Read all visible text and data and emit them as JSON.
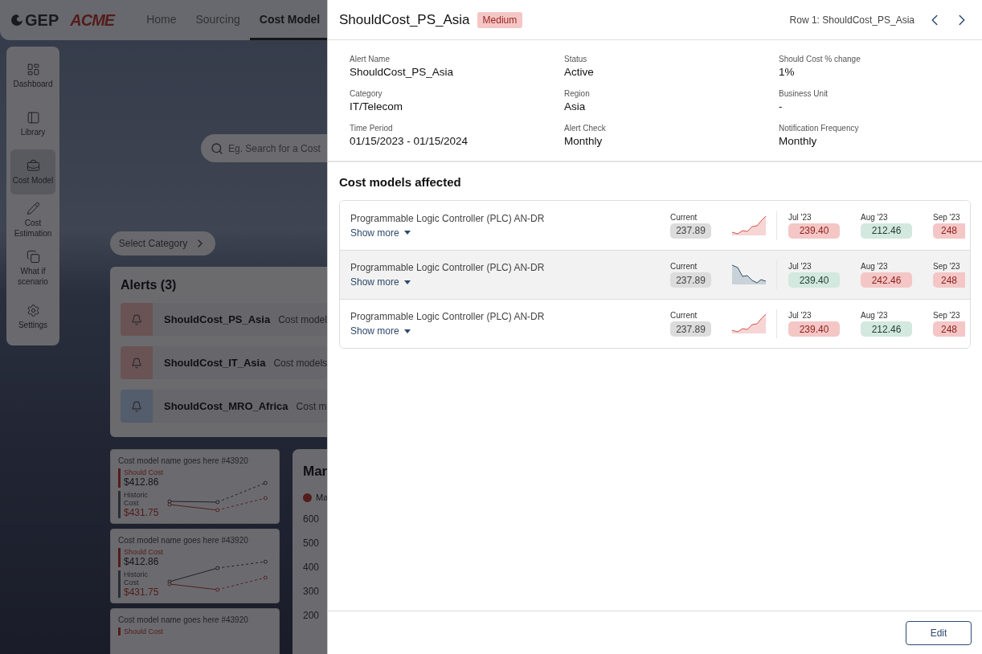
{
  "app": {
    "logo": "GEP",
    "brand": "ACME",
    "nav": [
      {
        "label": "Home",
        "selected": false
      },
      {
        "label": "Sourcing",
        "selected": false
      },
      {
        "label": "Cost Model",
        "selected": true
      }
    ],
    "sidebar": [
      {
        "label": "Dashboard",
        "selected": false
      },
      {
        "label": "Library",
        "selected": false
      },
      {
        "label": "Cost Model",
        "selected": true
      },
      {
        "label": "Cost Estimation",
        "selected": false
      },
      {
        "label": "What if scenario",
        "selected": false
      },
      {
        "label": "Settings",
        "selected": false
      }
    ],
    "search": {
      "placeholder": "Eg. Search for a Cost"
    },
    "category_button": "Select Category",
    "alerts": {
      "title": "Alerts (3)",
      "items": [
        {
          "name": "ShouldCost_PS_Asia",
          "text": "Cost model",
          "kind": "warning"
        },
        {
          "name": "ShouldCost_IT_Asia",
          "text": "Cost models",
          "kind": "warning"
        },
        {
          "name": "ShouldCost_MRO_Africa",
          "text": "Cost m",
          "kind": "info"
        }
      ]
    },
    "cost_cards": [
      {
        "title": "Cost model name goes here #43920",
        "should_label": "Should Cost",
        "should_value": "$412.86",
        "historic_label": "Historic Cost",
        "historic_value": "$431.75"
      },
      {
        "title": "Cost model name goes here #43920",
        "should_label": "Should Cost",
        "should_value": "$412.86",
        "historic_label": "Historic Cost",
        "historic_value": "$431.75"
      },
      {
        "title": "Cost model name goes here #43920",
        "should_label": "Should Cost"
      }
    ],
    "market_chart": {
      "title": "Mar",
      "legend": "Ma",
      "y_labels": [
        "600",
        "500",
        "400",
        "300",
        "200"
      ]
    }
  },
  "drawer": {
    "title": "ShouldCost_PS_Asia",
    "badge": "Medium",
    "row_label": "Row 1: ShouldCost_PS_Asia",
    "fields": [
      {
        "label": "Alert Name",
        "value": "ShouldCost_PS_Asia"
      },
      {
        "label": "Status",
        "value": "Active"
      },
      {
        "label": "Should Cost % change",
        "value": "1%"
      },
      {
        "label": "Category",
        "value": "IT/Telecom"
      },
      {
        "label": "Region",
        "value": "Asia"
      },
      {
        "label": "Business Unit",
        "value": "-"
      },
      {
        "label": "Time Period",
        "value": "01/15/2023 - 01/15/2024"
      },
      {
        "label": "Alert Check",
        "value": "Monthly"
      },
      {
        "label": "Notification Frequency",
        "value": "Monthly"
      }
    ],
    "section_title": "Cost models affected",
    "rows": [
      {
        "name": "Programmable Logic Controller (PLC) AN-DR",
        "show_more": "Show more",
        "current_label": "Current",
        "current_value": "237.89",
        "kind": "rising",
        "selected": false,
        "months": [
          {
            "label": "Jul '23",
            "value": "239.40",
            "kind": "increase"
          },
          {
            "label": "Aug '23",
            "value": "212.46",
            "kind": "decrease"
          },
          {
            "label": "Sep '23",
            "value": "248",
            "kind": "increase"
          }
        ]
      },
      {
        "name": "Programmable Logic Controller (PLC) AN-DR",
        "show_more": "Show more",
        "current_label": "Current",
        "current_value": "237.89",
        "kind": "falling",
        "selected": true,
        "months": [
          {
            "label": "Jul '23",
            "value": "239.40",
            "kind": "decrease"
          },
          {
            "label": "Aug '23",
            "value": "242.46",
            "kind": "increase"
          },
          {
            "label": "Sep '23",
            "value": "248",
            "kind": "increase"
          }
        ]
      },
      {
        "name": "Programmable Logic Controller (PLC) AN-DR",
        "show_more": "Show more",
        "current_label": "Current",
        "current_value": "237.89",
        "kind": "rising",
        "selected": false,
        "months": [
          {
            "label": "Jul '23",
            "value": "239.40",
            "kind": "increase"
          },
          {
            "label": "Aug '23",
            "value": "212.46",
            "kind": "decrease"
          },
          {
            "label": "Sep '23",
            "value": "248",
            "kind": "increase"
          }
        ]
      }
    ],
    "edit_button": "Edit"
  }
}
